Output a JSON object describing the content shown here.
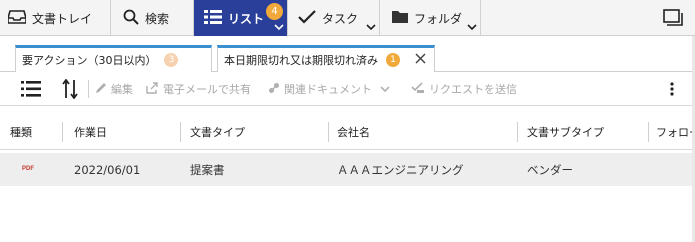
{
  "nav": {
    "items": [
      {
        "label": "文書トレイ",
        "icon": "inbox-tray-icon"
      },
      {
        "label": "検索",
        "icon": "search-icon"
      },
      {
        "label": "リスト",
        "icon": "list-icon",
        "badge": "4",
        "active": true
      },
      {
        "label": "タスク",
        "icon": "checkmark-icon"
      },
      {
        "label": "フォルダ",
        "icon": "folder-icon"
      }
    ],
    "right_icon": "window-icon"
  },
  "tabs": [
    {
      "label": "要アクション（30日以内）",
      "badge": "3",
      "badge_color": "#f7c9a0"
    },
    {
      "label": "本日期限切れ又は期限切れ済み",
      "badge": "1",
      "badge_color": "#f0a93a"
    }
  ],
  "toolbar": {
    "edit_label": "編集",
    "email_share_label": "電子メールで共有",
    "related_docs_label": "関連ドキュメント",
    "send_request_label": "リクエストを送信"
  },
  "table": {
    "columns": [
      "種類",
      "作業日",
      "文書タイプ",
      "会社名",
      "文書サブタイプ",
      "フォロー"
    ],
    "rows": [
      {
        "type_icon": "PDF",
        "work_date": "2022/06/01",
        "doc_type": "提案書",
        "company": "ＡＡＡエンジニアリング",
        "doc_subtype": "ベンダー"
      }
    ]
  },
  "colors": {
    "nav_active": "#2a3f9a",
    "badge": "#f0a93a",
    "tab_accent": "#3a8fd0",
    "row_bg": "#eeeeee"
  }
}
